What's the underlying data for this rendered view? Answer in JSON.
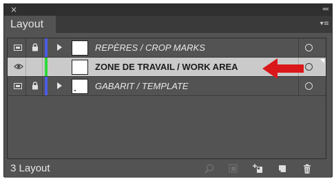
{
  "panel": {
    "close_glyph": "×",
    "collapse_glyph": "««",
    "tab_label": "Layout",
    "menu_glyph": "▾≡"
  },
  "layers": [
    {
      "name": "REPÈRES / CROP MARKS",
      "italic": true,
      "visible_icon": "visibility-toggle-icon",
      "locked": true,
      "color": "#4b5ce6",
      "has_children": true,
      "selected": false
    },
    {
      "name": "ZONE DE TRAVAIL / WORK AREA",
      "italic": false,
      "visible_icon": "eye-icon",
      "locked": false,
      "color": "#2fd83a",
      "has_children": false,
      "selected": true
    },
    {
      "name": "GABARIT / TEMPLATE",
      "italic": true,
      "visible_icon": "visibility-toggle-icon",
      "locked": true,
      "color": "#4b5ce6",
      "has_children": true,
      "selected": false
    }
  ],
  "annotation": {
    "arrow_color": "#d9181b"
  },
  "footer": {
    "layer_count": "3 Layout",
    "icons": [
      "search-icon",
      "make-clipping-mask-icon",
      "create-sublayer-icon",
      "new-layer-icon",
      "trash-icon"
    ]
  }
}
